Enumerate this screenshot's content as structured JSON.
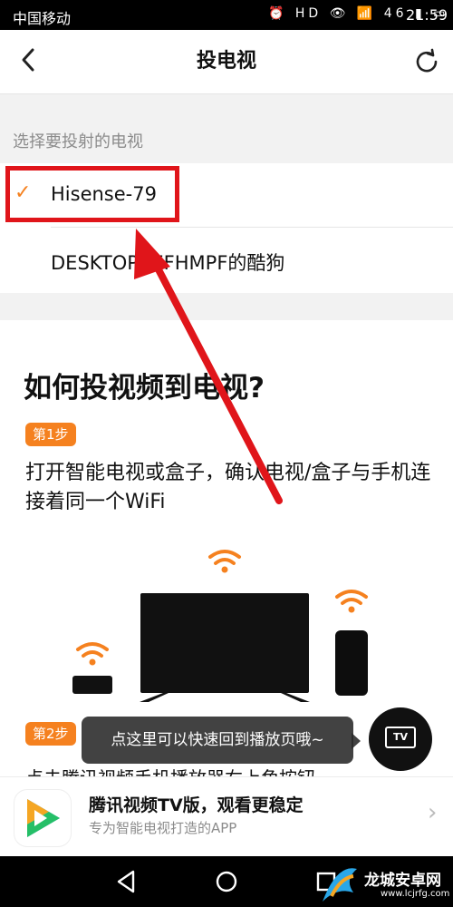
{
  "status_bar": {
    "carrier": "中国移动",
    "indicators": "⏰ HD 👁 📶 46 ▮ ▭",
    "time": "21:59"
  },
  "header": {
    "title": "投电视",
    "back_icon": "chevron-left-icon",
    "refresh_icon": "refresh-icon"
  },
  "device_section": {
    "label": "选择要投射的电视",
    "devices": [
      {
        "name": "Hisense-79",
        "selected": true
      },
      {
        "name": "DESKTOP-JEFHMPF的酷狗",
        "selected": false
      }
    ]
  },
  "howto": {
    "title": "如何投视频到电视?",
    "steps": [
      {
        "badge": "第1步",
        "text": "打开智能电视或盒子，确认电视/盒子与手机连接着同一个WiFi"
      },
      {
        "badge": "第2步",
        "text": "点击腾讯视频手机播放器右上角按钮"
      }
    ]
  },
  "tooltip": {
    "text": "点这里可以快速回到播放页哦~",
    "fab_label": "TV"
  },
  "banner": {
    "title": "腾讯视频TV版，观看更稳定",
    "subtitle": "专为智能电视打造的APP"
  },
  "watermark": {
    "name": "龙城安卓网",
    "url": "www.lcjrfg.com"
  },
  "colors": {
    "accent": "#f5811f",
    "annotation_red": "#e0151a"
  }
}
